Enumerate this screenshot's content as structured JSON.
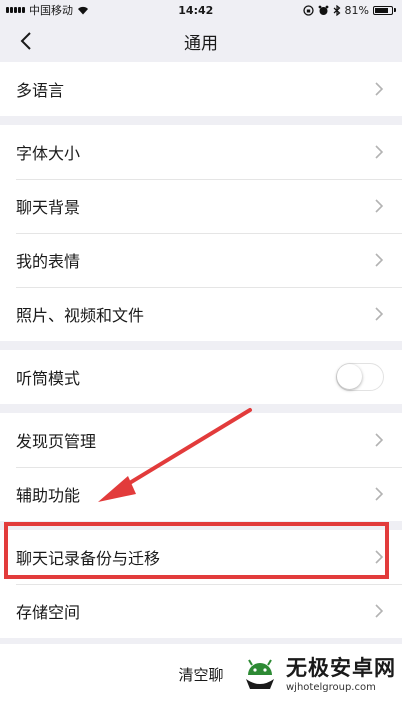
{
  "status_bar": {
    "carrier": "中国移动",
    "time": "14:42",
    "battery_percent": "81%",
    "battery_level": 0.81
  },
  "nav": {
    "title": "通用",
    "back_icon": "chevron-left-icon"
  },
  "sections": [
    {
      "items": [
        {
          "label": "多语言"
        }
      ]
    },
    {
      "items": [
        {
          "label": "字体大小"
        },
        {
          "label": "聊天背景"
        },
        {
          "label": "我的表情"
        },
        {
          "label": "照片、视频和文件"
        }
      ]
    },
    {
      "items": [
        {
          "label": "听筒模式",
          "toggle": false
        }
      ]
    },
    {
      "items": [
        {
          "label": "发现页管理"
        },
        {
          "label": "辅助功能"
        }
      ]
    },
    {
      "items": [
        {
          "label": "聊天记录备份与迁移",
          "highlighted": true
        },
        {
          "label": "存储空间"
        }
      ]
    }
  ],
  "bottom": {
    "label": "清空聊"
  },
  "annotation": {
    "color": "#e23b3b"
  },
  "watermark": {
    "name": "无极安卓网",
    "url": "wjhotelgroup.com"
  }
}
